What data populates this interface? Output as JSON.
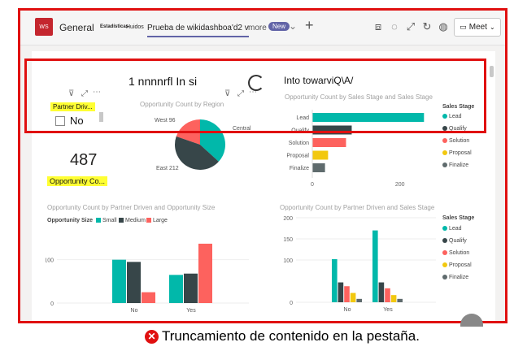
{
  "teams": {
    "app_logo": "WS",
    "tabs": [
      {
        "label": "General"
      },
      {
        "label": "Estadísticas"
      },
      {
        "label": "Huidos"
      },
      {
        "label": "Prueba de wikidashboa'd2 v"
      },
      {
        "label": "more"
      }
    ],
    "new_badge": "New",
    "meet_label": "Meet"
  },
  "overlay": {
    "garbled_text_1": "1 nnnnrfl In si",
    "garbled_text_2": "Into towarviQ\\A/"
  },
  "report": {
    "slicer_title": "Partner Driv...",
    "slicer_option": "No",
    "kpi_value": "487",
    "kpi_label": "Opportunity Co...",
    "region_title": "Opportunity Count by Region",
    "region_labels": {
      "west": "West 96",
      "central": "Central",
      "east": "East 212"
    },
    "stage_title": "Opportunity Count by Sales Stage and Sales Stage",
    "stage_legend_title": "Sales Stage",
    "partner_size_title": "Opportunity Count by Partner Driven and Opportunity Size",
    "size_legend_title": "Opportunity Size",
    "partner_stage_title": "Opportunity Count by Partner Driven and Sales Stage"
  },
  "colors": {
    "lead": "#01b8aa",
    "qualify": "#374649",
    "solution": "#fd625e",
    "proposal": "#f2c80f",
    "finalize": "#5f6b6d",
    "alert": "#e01010"
  },
  "chart_data": [
    {
      "type": "pie",
      "title": "Opportunity Count by Region",
      "categories": [
        "West",
        "Central",
        "East"
      ],
      "values": [
        96,
        179,
        212
      ]
    },
    {
      "type": "bar",
      "orientation": "horizontal",
      "title": "Opportunity Count by Sales Stage and Sales Stage",
      "categories": [
        "Lead",
        "Qualify",
        "Solution",
        "Proposal",
        "Finalize"
      ],
      "values": [
        255,
        90,
        77,
        36,
        29
      ],
      "xlim": [
        0,
        260
      ],
      "xticks": [
        "0",
        "200"
      ],
      "legend": {
        "title": "Sales Stage",
        "placement": "right",
        "entries": [
          "Lead",
          "Qualify",
          "Solution",
          "Proposal",
          "Finalize"
        ]
      }
    },
    {
      "type": "bar",
      "title": "Opportunity Count by Partner Driven and Opportunity Size",
      "categories": [
        "No",
        "Yes"
      ],
      "series": [
        {
          "name": "Small",
          "values": [
            100,
            65
          ]
        },
        {
          "name": "Medium",
          "values": [
            95,
            68
          ]
        },
        {
          "name": "Large",
          "values": [
            25,
            137
          ]
        }
      ],
      "ylim": [
        0,
        150
      ],
      "yticks": [
        "0",
        "100"
      ],
      "legend": {
        "title": "Opportunity Size",
        "placement": "top-left"
      }
    },
    {
      "type": "bar",
      "title": "Opportunity Count by Partner Driven and Sales Stage",
      "categories": [
        "No",
        "Yes"
      ],
      "series": [
        {
          "name": "Lead",
          "values": [
            102,
            170
          ]
        },
        {
          "name": "Qualify",
          "values": [
            47,
            47
          ]
        },
        {
          "name": "Solution",
          "values": [
            38,
            33
          ]
        },
        {
          "name": "Proposal",
          "values": [
            22,
            17
          ]
        },
        {
          "name": "Finalize",
          "values": [
            8,
            8
          ]
        }
      ],
      "ylim": [
        0,
        200
      ],
      "yticks": [
        "0",
        "100",
        "150",
        "200"
      ],
      "legend": {
        "title": "Sales Stage",
        "placement": "right"
      }
    }
  ],
  "caption": {
    "text": "Truncamiento de contenido en la pestaña."
  }
}
